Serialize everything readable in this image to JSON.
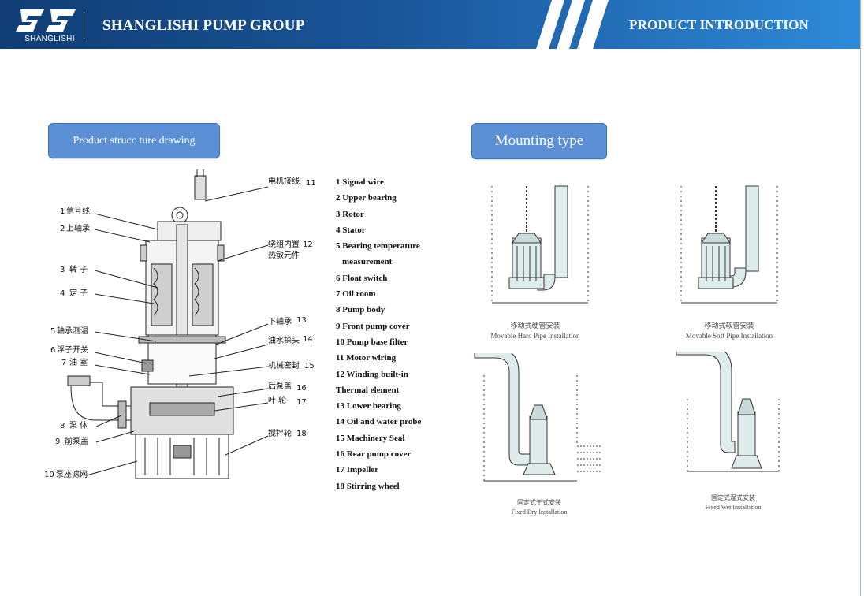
{
  "header": {
    "logo_text": "SHANGLISHI",
    "company": "SHANGLISHI PUMP GROUP",
    "section": "PRODUCT INTRODUCTION"
  },
  "structure": {
    "button_label": "Product strucc ture drawing",
    "callouts": [
      {
        "num": "1",
        "cn": "信号线"
      },
      {
        "num": "2",
        "cn": "上轴承"
      },
      {
        "num": "3",
        "cn": "转 子"
      },
      {
        "num": "4",
        "cn": "定 子"
      },
      {
        "num": "5",
        "cn": "轴承测温"
      },
      {
        "num": "6",
        "cn": "浮子开关"
      },
      {
        "num": "7",
        "cn": "油 室"
      },
      {
        "num": "8",
        "cn": "泵 体"
      },
      {
        "num": "9",
        "cn": "前泵盖"
      },
      {
        "num": "10",
        "cn": "泵座滤网"
      },
      {
        "num": "11",
        "cn": "电机接线"
      },
      {
        "num": "12",
        "cn": "绕组内置"
      },
      {
        "num": "12b",
        "cn": "热敏元件"
      },
      {
        "num": "13",
        "cn": "下轴承"
      },
      {
        "num": "14",
        "cn": "油水探头"
      },
      {
        "num": "15",
        "cn": "机械密封"
      },
      {
        "num": "16",
        "cn": "后泵盖"
      },
      {
        "num": "17",
        "cn": "叶 轮"
      },
      {
        "num": "18",
        "cn": "搅拌轮"
      }
    ],
    "parts": [
      "1 Signal wire",
      "2 Upper bearing",
      "3 Rotor",
      "4 Stator",
      "5 Bearing temperature",
      "measurement",
      "6 Float switch",
      "7 Oil room",
      "8 Pump body",
      "9 Front pump cover",
      "10 Pump base filter",
      "11 Motor wiring",
      "12 Winding built-in",
      "Thermal element",
      "13 Lower bearing",
      "14 Oil and water probe",
      "15 Machinery Seal",
      "16 Rear pump cover",
      "17 Impeller",
      "18 Stirring wheel"
    ]
  },
  "mounting": {
    "button_label": "Mounting type",
    "items": [
      {
        "cn": "移动式硬管安装",
        "en": "Movable Hard Pipe Installation"
      },
      {
        "cn": "移动式软管安装",
        "en": "Movable Soft Pipe Installation"
      },
      {
        "cn": "固定式干式安装",
        "en": "Fixed Dry Installation"
      },
      {
        "cn": "固定式湿式安装",
        "en": "Fixed Wet Installation"
      }
    ]
  },
  "colors": {
    "header_dark": "#103d74",
    "header_light": "#2e8ad9",
    "button_fill": "#5b8fd6",
    "pipe_fill": "#dfecec"
  }
}
